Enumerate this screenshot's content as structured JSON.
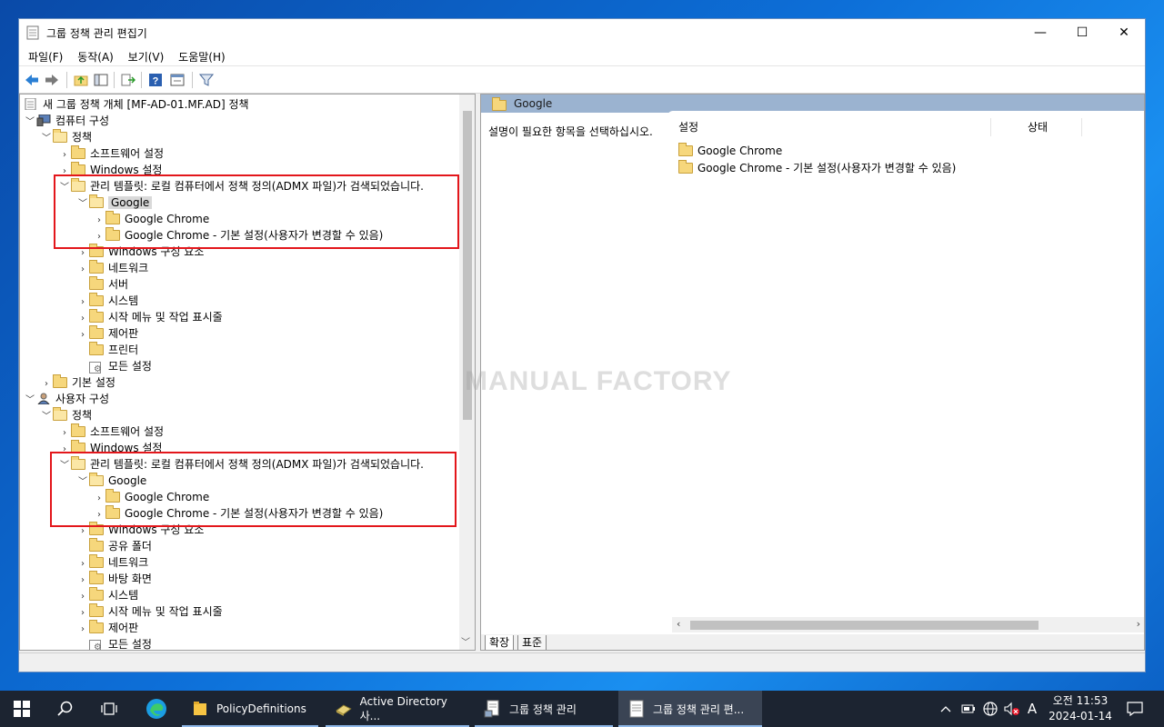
{
  "window": {
    "title": "그룹 정책 관리 편집기",
    "controls": {
      "minimize": "—",
      "maximize": "☐",
      "close": "✕"
    }
  },
  "menu": [
    "파일(F)",
    "동작(A)",
    "보기(V)",
    "도움말(H)"
  ],
  "toolbar": {
    "buttons": [
      "back-arrow-icon",
      "forward-arrow-icon",
      "up-folder-icon",
      "show-hide-tree-icon",
      "export-list-icon",
      "help-icon",
      "properties-icon",
      "filter-icon"
    ]
  },
  "tree": {
    "root": "새 그룹 정책 개체 [MF-AD-01.MF.AD] 정책",
    "computer": {
      "label": "컴퓨터 구성",
      "policies": "정책",
      "software": "소프트웨어 설정",
      "windows": "Windows 설정",
      "admin": "관리 템플릿: 로컬 컴퓨터에서 정책 정의(ADMX 파일)가 검색되었습니다.",
      "google": "Google",
      "chrome": "Google Chrome",
      "chrome_default": "Google Chrome - 기본 설정(사용자가 변경할 수 있음)",
      "windows_components": "Windows 구성 요소",
      "network": "네트워크",
      "server": "서버",
      "system": "시스템",
      "start_menu": "시작 메뉴 및 작업 표시줄",
      "control_panel": "제어판",
      "printers": "프린터",
      "all_settings": "모든 설정",
      "preferences": "기본 설정"
    },
    "user": {
      "label": "사용자 구성",
      "policies": "정책",
      "software": "소프트웨어 설정",
      "windows": "Windows 설정",
      "admin": "관리 템플릿: 로컬 컴퓨터에서 정책 정의(ADMX 파일)가 검색되었습니다.",
      "google": "Google",
      "chrome": "Google Chrome",
      "chrome_default": "Google Chrome - 기본 설정(사용자가 변경할 수 있음)",
      "windows_components": "Windows 구성 요소",
      "shared_folders": "공유 폴더",
      "network": "네트워크",
      "desktop": "바탕 화면",
      "system": "시스템",
      "start_menu": "시작 메뉴 및 작업 표시줄",
      "control_panel": "제어판",
      "all_settings": "모든 설정"
    }
  },
  "right_pane": {
    "header": "Google",
    "description": "설명이 필요한 항목을 선택하십시오.",
    "columns": {
      "setting": "설정",
      "state": "상태"
    },
    "items": [
      "Google Chrome",
      "Google Chrome - 기본 설정(사용자가 변경할 수 있음)"
    ],
    "tabs": {
      "extended": "확장",
      "standard": "표준"
    }
  },
  "watermark": "MANUAL FACTORY",
  "taskbar": {
    "apps": [
      {
        "label": "PolicyDefinitions"
      },
      {
        "label": "Active Directory 사..."
      },
      {
        "label": "그룹 정책 관리"
      },
      {
        "label": "그룹 정책 관리 편..."
      }
    ],
    "ime": "A",
    "clock": {
      "time": "오전 11:53",
      "date": "2024-01-14"
    }
  }
}
